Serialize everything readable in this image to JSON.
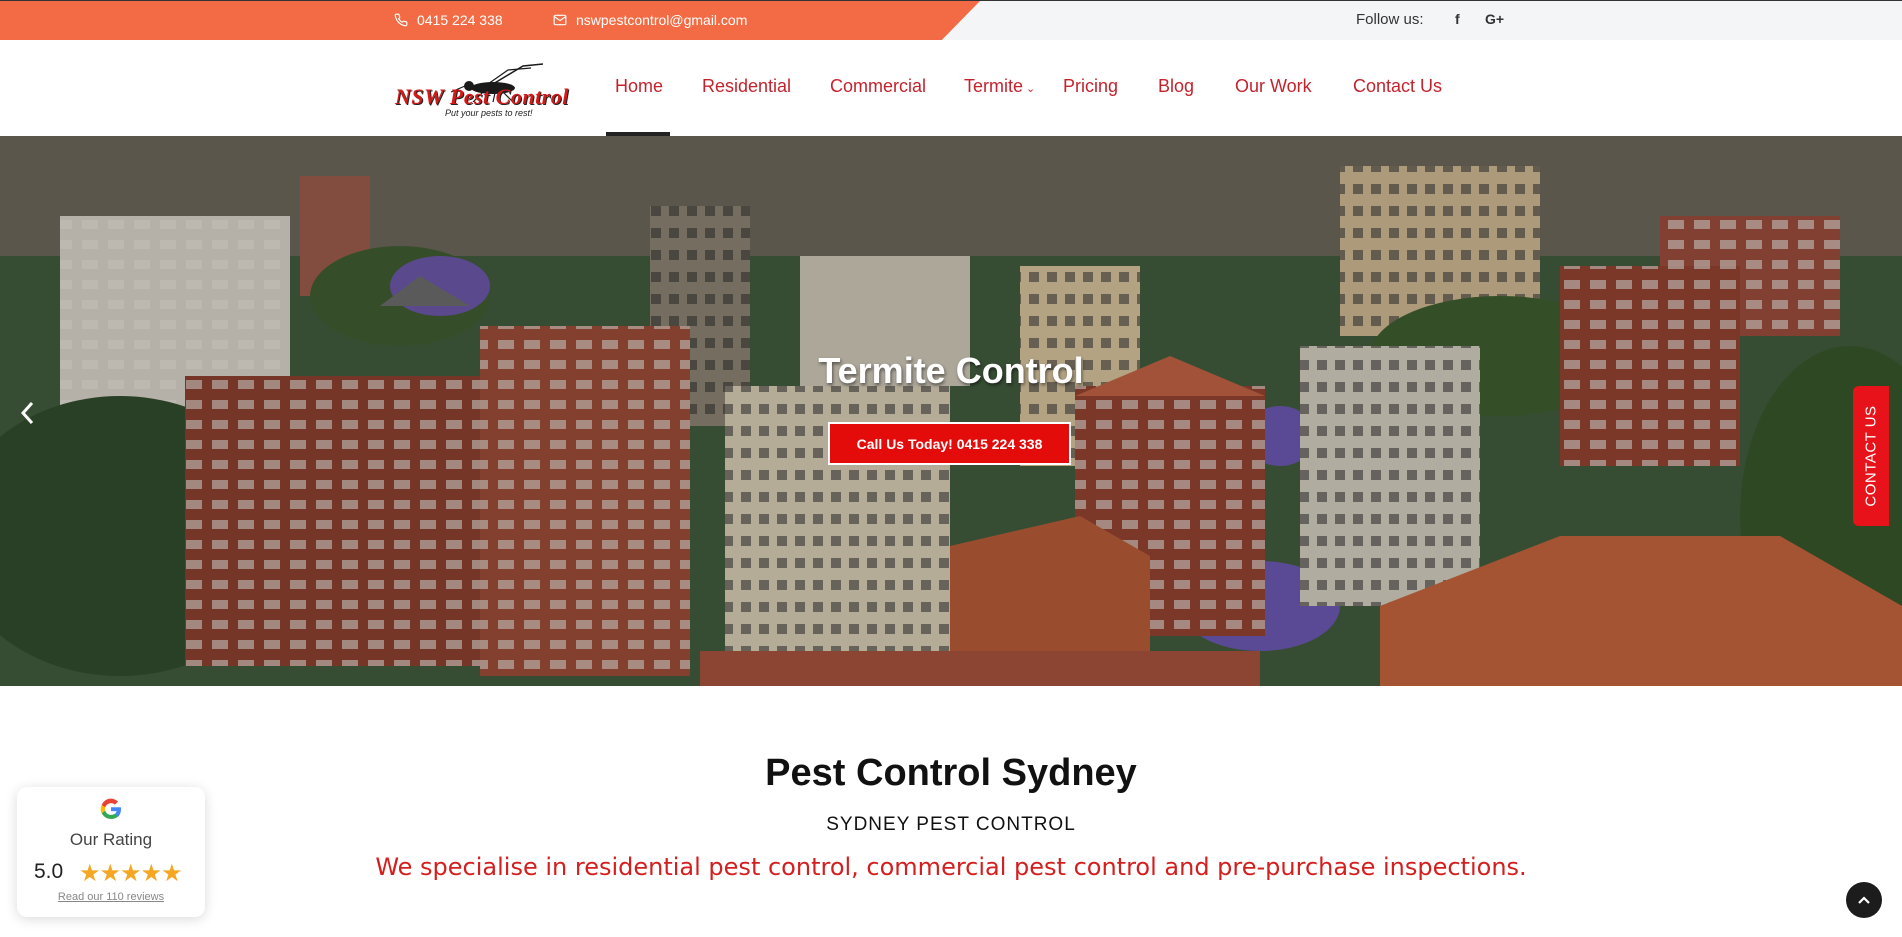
{
  "topbar": {
    "phone": "0415 224 338",
    "email": "nswpestcontrol@gmail.com",
    "follow_label": "Follow us:",
    "social": [
      {
        "label": "f",
        "icon": "facebook-icon"
      },
      {
        "label": "G+",
        "icon": "google-plus-icon"
      }
    ],
    "accent_color": "#f26b44"
  },
  "header": {
    "logo_text": "NSW Pest Control",
    "logo_tagline": "Put your pests to rest!",
    "nav": [
      {
        "label": "Home",
        "active": true
      },
      {
        "label": "Residential"
      },
      {
        "label": "Commercial"
      },
      {
        "label": "Termite",
        "has_dropdown": true
      },
      {
        "label": "Pricing"
      },
      {
        "label": "Blog"
      },
      {
        "label": "Our Work"
      },
      {
        "label": "Contact Us"
      }
    ],
    "nav_color": "#c4232d"
  },
  "hero": {
    "title": "Termite Control",
    "cta_label": "Call Us Today! 0415 224 338",
    "contact_tab_label": "CONTACT US",
    "cta_color": "#e40b0b"
  },
  "content": {
    "title": "Pest Control Sydney",
    "subtitle": "SYDNEY PEST CONTROL",
    "tagline": "We specialise in residential pest control, commercial pest control and pre-purchase inspections.",
    "tagline_color": "#d41f1f"
  },
  "rating_widget": {
    "title": "Our Rating",
    "score": "5.0",
    "stars": 5,
    "link": "Read our 110 reviews",
    "star_color": "#f5a623"
  }
}
